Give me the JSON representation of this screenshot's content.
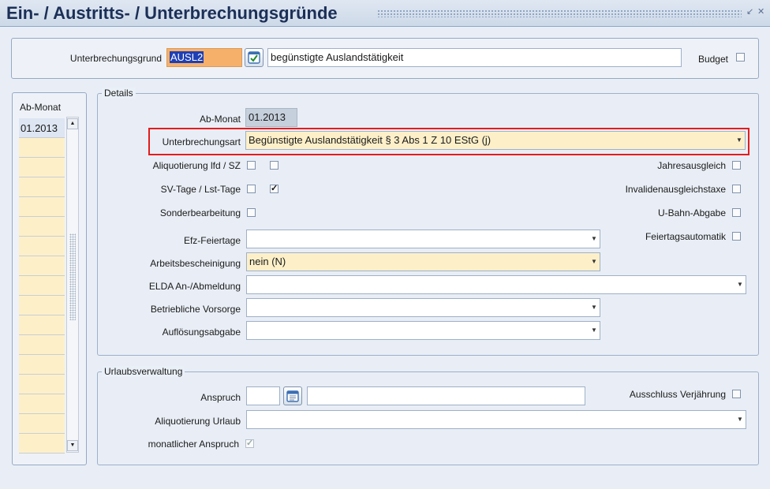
{
  "window": {
    "title": "Ein- / Austritts- / Unterbrechungsgründe",
    "restore_icon": "restore-icon",
    "close_icon": "close-icon"
  },
  "header": {
    "unterbrechungsgrund_label": "Unterbrechungsgrund",
    "code_value": "AUSL2",
    "description_value": "begünstigte Auslandstätigkeit",
    "budget_label": "Budget",
    "budget_checked": false
  },
  "list": {
    "header": "Ab-Monat",
    "items": [
      "01.2013",
      "",
      "",
      "",
      "",
      "",
      "",
      "",
      "",
      "",
      "",
      "",
      "",
      "",
      "",
      "",
      ""
    ]
  },
  "details": {
    "group_title": "Details",
    "ab_monat_label": "Ab-Monat",
    "ab_monat_value": "01.2013",
    "unterbrechungsart_label": "Unterbrechungsart",
    "unterbrechungsart_value": "Begünstigte Auslandstätigkeit § 3 Abs 1 Z 10 EStG (j)",
    "aliquotierung_label": "Aliquotierung lfd / SZ",
    "aliquotierung_lfd_checked": false,
    "aliquotierung_sz_checked": false,
    "svtage_label": "SV-Tage / Lst-Tage",
    "sv_tage_checked": false,
    "lst_tage_checked": true,
    "sonderbearbeitung_label": "Sonderbearbeitung",
    "sonderbearbeitung_checked": false,
    "jahresausgleich_label": "Jahresausgleich",
    "invalidenausgleichstaxe_label": "Invalidenausgleichstaxe",
    "ubahn_label": "U-Bahn-Abgabe",
    "feiertagsautomatik_label": "Feiertagsautomatik",
    "efz_label": "Efz-Feiertage",
    "efz_value": "",
    "arbeitsbescheinigung_label": "Arbeitsbescheinigung",
    "arbeitsbescheinigung_value": "nein (N)",
    "elda_label": "ELDA An-/Abmeldung",
    "elda_value": "",
    "vorsorge_label": "Betriebliche Vorsorge",
    "vorsorge_value": "",
    "aufloesung_label": "Auflösungsabgabe",
    "aufloesung_value": ""
  },
  "urlaub": {
    "group_title": "Urlaubsverwaltung",
    "anspruch_label": "Anspruch",
    "anspruch_value": "",
    "anspruch_text_value": "",
    "ausschluss_label": "Ausschluss Verjährung",
    "aliquotierung_label": "Aliquotierung Urlaub",
    "aliquotierung_value": "",
    "monatlich_label": "monatlicher Anspruch",
    "monatlich_checked": true
  },
  "colors": {
    "highlight": "#e21d1d",
    "field_yellow": "#fdf0c9",
    "field_orange": "#f7b06a",
    "title": "#1b2f57"
  }
}
